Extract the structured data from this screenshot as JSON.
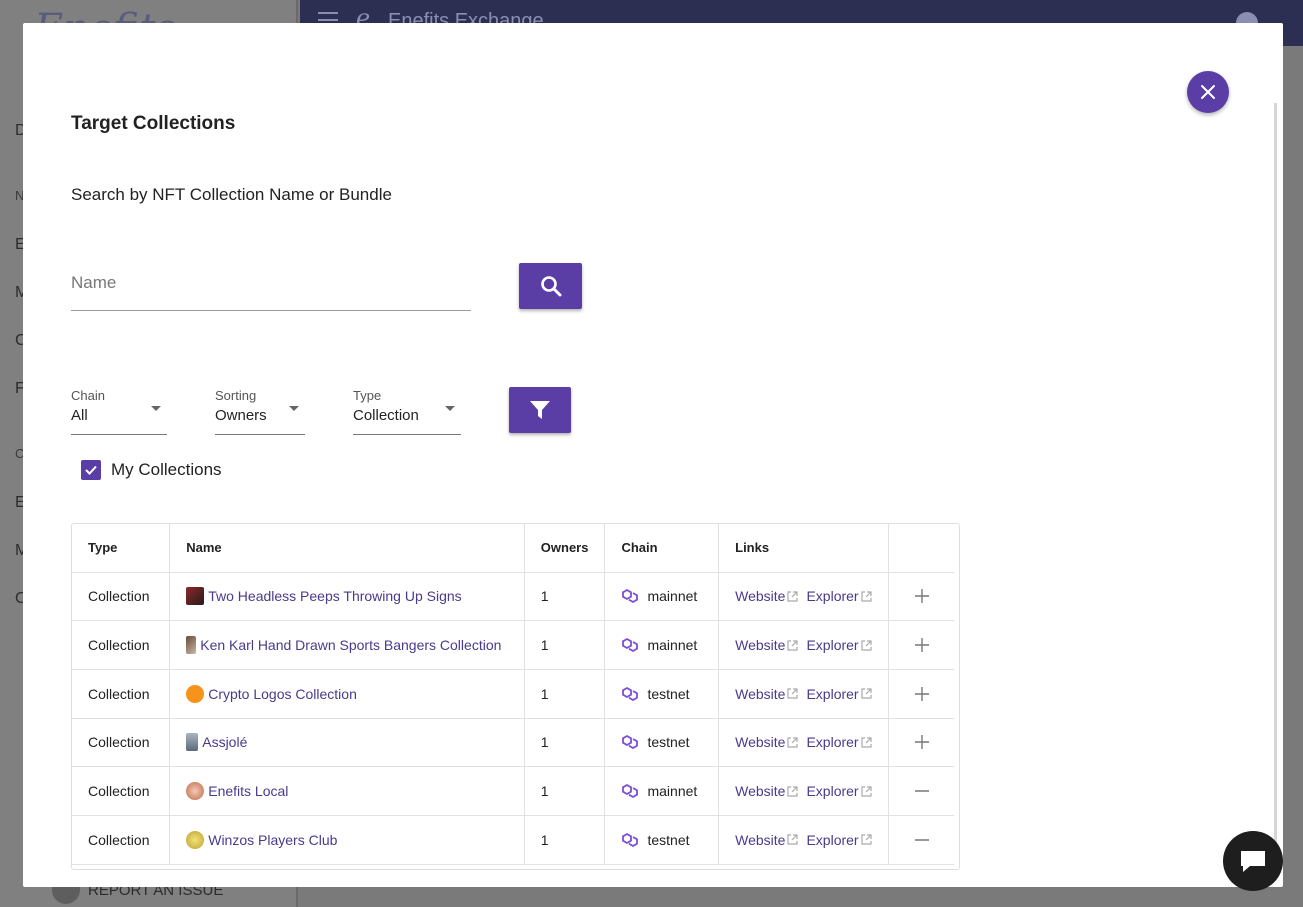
{
  "background": {
    "app_title": "Enefits Exchange",
    "logo_text": "Enefits",
    "sidebar_letters": [
      "D",
      "N",
      "E",
      "M",
      "C",
      "F",
      "C",
      "E",
      "M",
      "C"
    ],
    "report_label": "REPORT AN ISSUE"
  },
  "modal": {
    "title": "Target Collections",
    "search_label": "Search by NFT Collection Name or Bundle",
    "name_placeholder": "Name",
    "name_value": "",
    "filters": {
      "chain": {
        "label": "Chain",
        "value": "All"
      },
      "sorting": {
        "label": "Sorting",
        "value": "Owners"
      },
      "type": {
        "label": "Type",
        "value": "Collection"
      }
    },
    "my_collections": {
      "label": "My Collections",
      "checked": true
    },
    "table": {
      "headers": [
        "Type",
        "Name",
        "Owners",
        "Chain",
        "Links",
        ""
      ],
      "rows": [
        {
          "type": "Collection",
          "name": "Two Headless Peeps Throwing Up Signs",
          "owners": "1",
          "chain": "mainnet",
          "website": "Website",
          "explorer": "Explorer",
          "action": "add"
        },
        {
          "type": "Collection",
          "name": "Ken Karl Hand Drawn Sports Bangers Collection",
          "owners": "1",
          "chain": "mainnet",
          "website": "Website",
          "explorer": "Explorer",
          "action": "add"
        },
        {
          "type": "Collection",
          "name": "Crypto Logos Collection",
          "owners": "1",
          "chain": "testnet",
          "website": "Website",
          "explorer": "Explorer",
          "action": "add"
        },
        {
          "type": "Collection",
          "name": "Assjolé",
          "owners": "1",
          "chain": "testnet",
          "website": "Website",
          "explorer": "Explorer",
          "action": "add"
        },
        {
          "type": "Collection",
          "name": "Enefits Local",
          "owners": "1",
          "chain": "mainnet",
          "website": "Website",
          "explorer": "Explorer",
          "action": "remove"
        },
        {
          "type": "Collection",
          "name": "Winzos Players Club",
          "owners": "1",
          "chain": "testnet",
          "website": "Website",
          "explorer": "Explorer",
          "action": "remove"
        }
      ]
    }
  },
  "colors": {
    "accent": "#5b3da6",
    "link": "#4b3a8c",
    "chain_icon": "#7b4fd6"
  }
}
